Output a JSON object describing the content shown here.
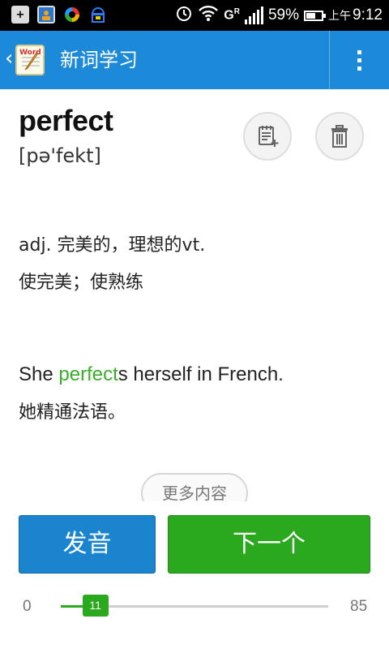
{
  "status_bar": {
    "network_label": "G",
    "network_badge": "R",
    "battery_text": "59%",
    "battery_level": 0.59,
    "time_ampm": "上午",
    "time": "9:12",
    "icons": [
      "plus-box-icon",
      "contact-card-icon",
      "sync-app-icon",
      "android-bot-icon",
      "alarm-clock-icon",
      "wifi-icon",
      "signal-icon",
      "battery-icon"
    ]
  },
  "action_bar": {
    "title": "新词学习",
    "back_glyph": "‹",
    "logo_text": "Word",
    "menu_icon": "overflow-menu-icon"
  },
  "word": {
    "text": "perfect",
    "phonetic": "[pə'fekt]"
  },
  "definition": "adj. 完美的，理想的vt.\n使完美；使熟练",
  "example": {
    "en_before": "She ",
    "en_highlight": "perfect",
    "en_after": "s herself in French.",
    "cn": "她精通法语。",
    "highlight_color": "#3aae2a"
  },
  "more_button": "更多内容",
  "speak_button": "发音",
  "next_button": "下一个",
  "progress": {
    "min": "0",
    "max": "85",
    "current": "11",
    "min_value": 0,
    "max_value": 85,
    "current_value": 11
  },
  "colors": {
    "action_bar": "#1c8ad8",
    "speak_button": "#1a84cf",
    "next_button": "#2aa81e"
  }
}
